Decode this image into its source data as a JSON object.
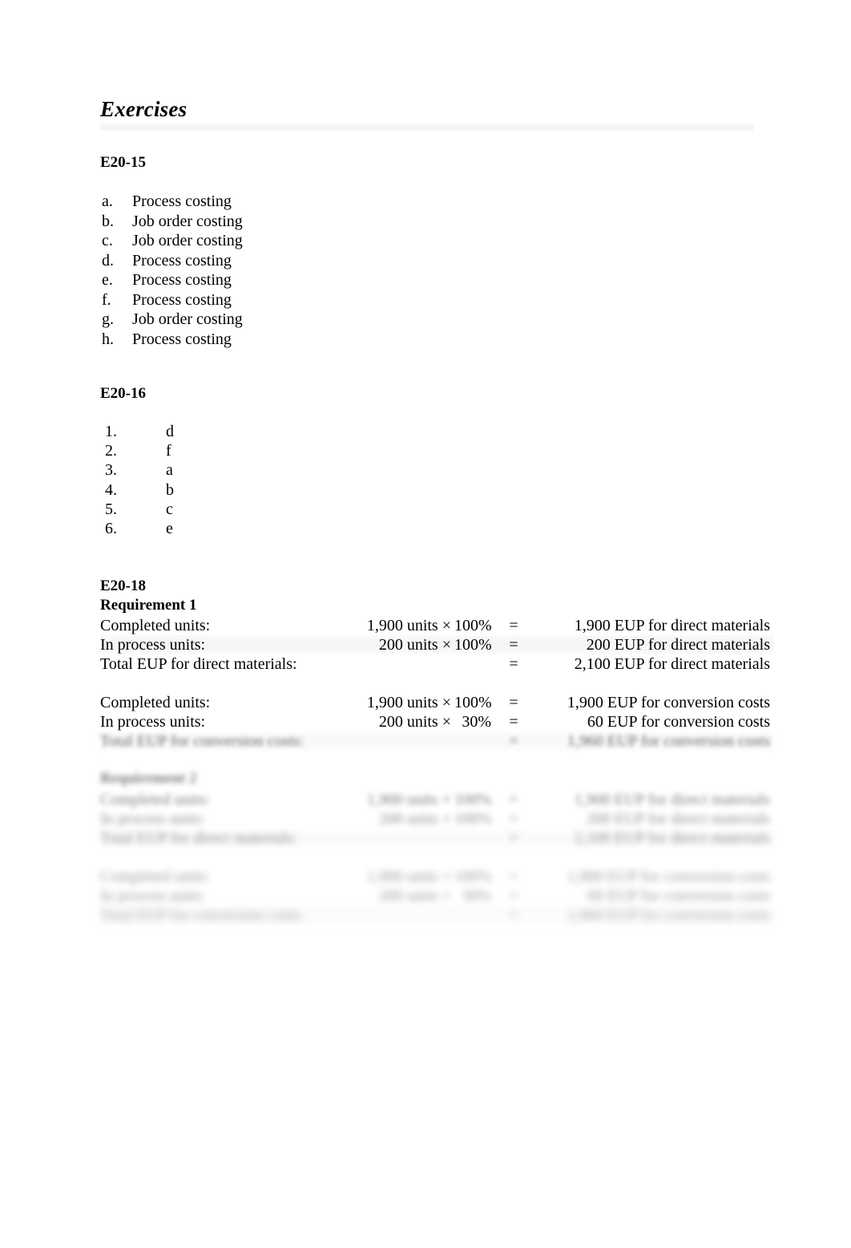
{
  "document": {
    "heading": "Exercises"
  },
  "sections": [
    {
      "id": "e20-15",
      "label": "E20-15",
      "items": [
        {
          "marker": "a.",
          "text": "Process costing"
        },
        {
          "marker": "b.",
          "text": "Job order costing"
        },
        {
          "marker": "c.",
          "text": "Job order costing"
        },
        {
          "marker": "d.",
          "text": "Process costing"
        },
        {
          "marker": "e.",
          "text": "Process costing"
        },
        {
          "marker": "f.",
          "text": "Process costing"
        },
        {
          "marker": "g.",
          "text": "Job order costing"
        },
        {
          "marker": "h.",
          "text": "Process costing"
        }
      ]
    },
    {
      "id": "e20-16",
      "label": "E20-16",
      "items": [
        {
          "marker": "1.",
          "text": "d"
        },
        {
          "marker": "2.",
          "text": "f"
        },
        {
          "marker": "3.",
          "text": "a"
        },
        {
          "marker": "4.",
          "text": "b"
        },
        {
          "marker": "5.",
          "text": "c"
        },
        {
          "marker": "6.",
          "text": "e"
        }
      ]
    },
    {
      "id": "e20-18",
      "label": "E20-18",
      "requirement1_label": "Requirement 1",
      "requirement2_label": "Requirement 2",
      "req1_materials": [
        {
          "label": "Completed units:",
          "units": "1,900 units ×",
          "pct": "100%",
          "eq": "=",
          "result": "1,900 EUP for direct materials"
        },
        {
          "label": "In process units:",
          "units": "200 units ×",
          "pct": "100%",
          "eq": "=",
          "result": "200 EUP for direct materials"
        },
        {
          "label": "Total EUP for direct materials:",
          "units": "",
          "pct": "",
          "eq": "=",
          "result": "2,100 EUP for direct materials"
        }
      ],
      "req1_conversion": [
        {
          "label": "Completed units:",
          "units": "1,900 units ×",
          "pct": "100%",
          "eq": "=",
          "result": "1,900 EUP for conversion costs"
        },
        {
          "label": "In process units:",
          "units": "200 units ×",
          "pct": "30%",
          "eq": "=",
          "result": "60 EUP for conversion costs"
        },
        {
          "label": "Total EUP for conversion costs:",
          "units": "",
          "pct": "",
          "eq": "=",
          "result": "1,960 EUP for conversion costs"
        }
      ],
      "req2_materials": [
        {
          "label": "Completed units:",
          "units": "1,900 units ×",
          "pct": "100%",
          "eq": "=",
          "result": "1,900 EUP for direct materials"
        },
        {
          "label": "In process units:",
          "units": "200 units ×",
          "pct": "100%",
          "eq": "=",
          "result": "200 EUP for direct materials"
        },
        {
          "label": "Total EUP for direct materials:",
          "units": "",
          "pct": "",
          "eq": "=",
          "result": "2,100 EUP for direct materials"
        }
      ],
      "req2_conversion": [
        {
          "label": "Completed units:",
          "units": "1,900 units ×",
          "pct": "100%",
          "eq": "=",
          "result": "1,900 EUP for conversion costs"
        },
        {
          "label": "In process units:",
          "units": "200 units ×",
          "pct": "30%",
          "eq": "=",
          "result": "60 EUP for conversion costs"
        },
        {
          "label": "Total EUP for conversion costs:",
          "units": "",
          "pct": "",
          "eq": "=",
          "result": "1,960 EUP for conversion costs"
        }
      ]
    }
  ]
}
